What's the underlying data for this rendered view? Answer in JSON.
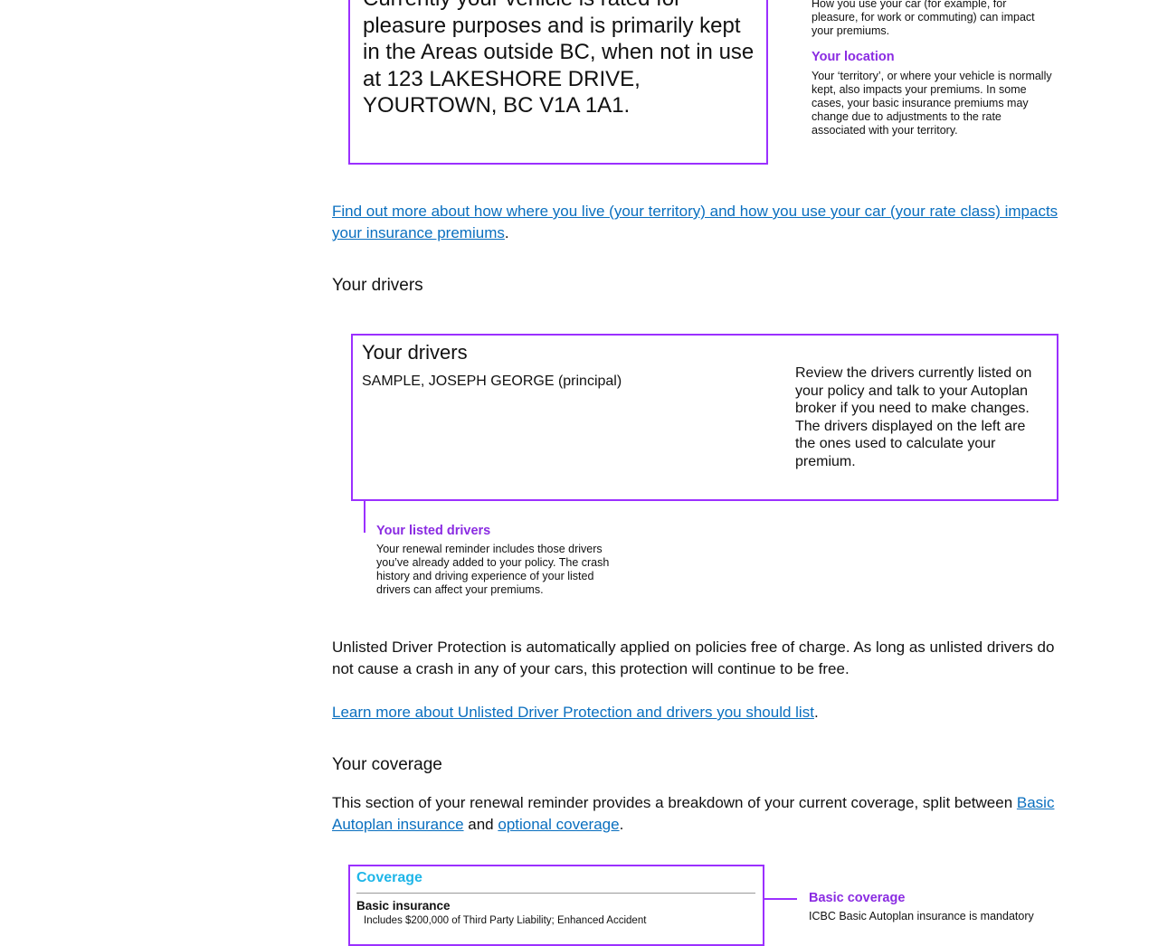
{
  "rate_box": {
    "text": "Currently your vehicle is rated for pleasure purposes and is primarily kept in the Areas outside BC, when not in use at 123 LAKESHORE DRIVE, YOURTOWN, BC  V1A 1A1."
  },
  "rate_annotations": {
    "usage_body": "How you use your car (for example, for pleasure, for work or commuting) can impact your premiums.",
    "location_title": "Your location",
    "location_body": "Your ‘territory’, or where your vehicle is normally kept, also impacts your premiums. In some cases, your basic insurance premiums may change due to adjustments to the rate associated with your territory."
  },
  "territory_link": {
    "text": "Find out more about how where you live (your territory) and how you use your car (your rate class) impacts your insurance premiums",
    "suffix": "."
  },
  "drivers_section": {
    "heading": "Your drivers",
    "box_title": "Your drivers",
    "driver_name": "SAMPLE, JOSEPH GEORGE (principal)",
    "review_text": "Review the drivers currently listed on your policy and talk to your Autoplan broker if you need to make changes. The drivers displayed on the left are the ones used to calculate your premium.",
    "listed_title": "Your listed drivers",
    "listed_body": "Your renewal reminder includes those drivers you’ve already added to your policy. The crash history and driving experience of your listed drivers can affect your premiums."
  },
  "unlisted": {
    "text": "Unlisted Driver Protection is automatically applied on policies free of charge. As long as unlisted drivers do not cause a crash in any of your cars, this protection will continue to be free.",
    "link": "Learn more about Unlisted Driver Protection and drivers you should list",
    "suffix": "."
  },
  "coverage_section": {
    "heading": "Your coverage",
    "text_prefix": "This section of your renewal reminder provides a breakdown of your current coverage, split between ",
    "basic_link": "Basic Autoplan insurance",
    "and": " and ",
    "optional_link": "optional coverage",
    "suffix": ".",
    "box_title": "Coverage",
    "basic_label": "Basic insurance",
    "basic_detail": "Includes $200,000 of Third Party Liability; Enhanced Accident",
    "annot_title": "Basic coverage",
    "annot_body": "ICBC Basic Autoplan insurance is mandatory"
  },
  "colors": {
    "accent_purple": "#9b30ff",
    "link_blue": "#0a6fbf",
    "coverage_cyan": "#1fb6e8"
  }
}
